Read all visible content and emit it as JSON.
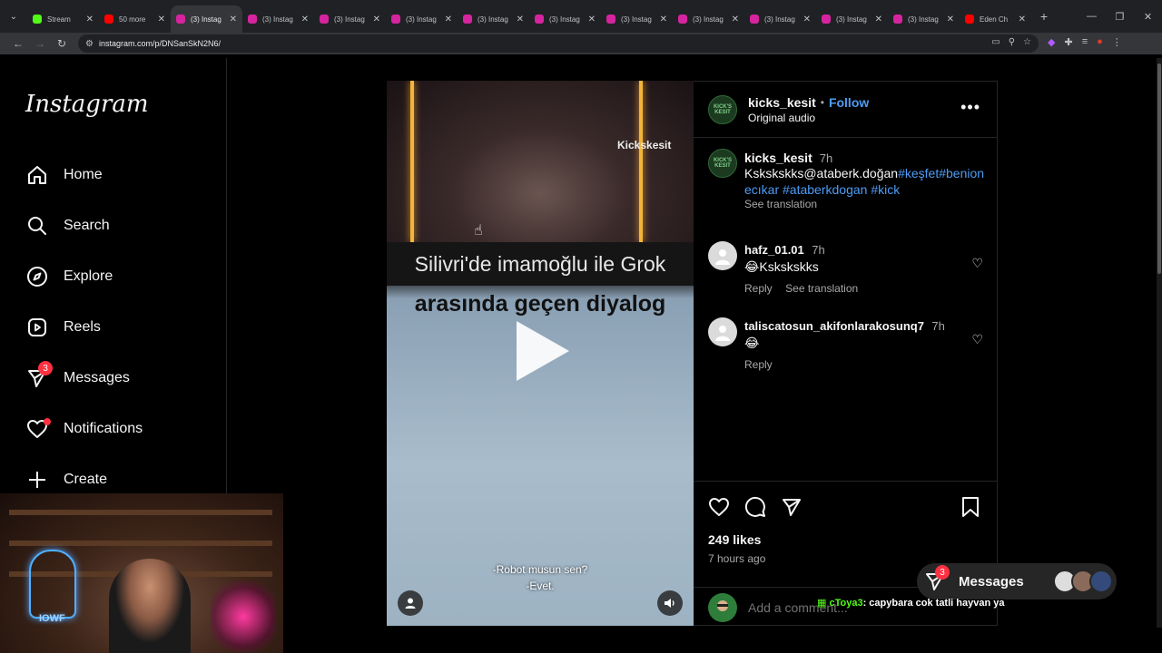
{
  "browser": {
    "tabs": [
      {
        "title": "Stream",
        "favicon_color": "#53fc18",
        "active": false
      },
      {
        "title": "50 more",
        "favicon_color": "#ff0000",
        "active": false
      },
      {
        "title": "(3) Instag",
        "favicon_color": "#d6249f",
        "active": true
      },
      {
        "title": "(3) Instag",
        "favicon_color": "#d6249f",
        "active": false
      },
      {
        "title": "(3) Instag",
        "favicon_color": "#d6249f",
        "active": false
      },
      {
        "title": "(3) Instag",
        "favicon_color": "#d6249f",
        "active": false
      },
      {
        "title": "(3) Instag",
        "favicon_color": "#d6249f",
        "active": false
      },
      {
        "title": "(3) Instag",
        "favicon_color": "#d6249f",
        "active": false
      },
      {
        "title": "(3) Instag",
        "favicon_color": "#d6249f",
        "active": false
      },
      {
        "title": "(3) Instag",
        "favicon_color": "#d6249f",
        "active": false
      },
      {
        "title": "(3) Instag",
        "favicon_color": "#d6249f",
        "active": false
      },
      {
        "title": "(3) Instag",
        "favicon_color": "#d6249f",
        "active": false
      },
      {
        "title": "(3) Instag",
        "favicon_color": "#d6249f",
        "active": false
      },
      {
        "title": "Eden Ch",
        "favicon_color": "#ff0000",
        "active": false
      }
    ],
    "url": "instagram.com/p/DNSanSkN2N6/"
  },
  "sidebar": {
    "logo": "Instagram",
    "items": [
      {
        "label": "Home",
        "icon": "home-icon"
      },
      {
        "label": "Search",
        "icon": "search-icon"
      },
      {
        "label": "Explore",
        "icon": "compass-icon"
      },
      {
        "label": "Reels",
        "icon": "reels-icon"
      },
      {
        "label": "Messages",
        "icon": "messenger-icon",
        "badge": "3"
      },
      {
        "label": "Notifications",
        "icon": "heart-icon",
        "dot": true
      },
      {
        "label": "Create",
        "icon": "plus-icon"
      }
    ]
  },
  "video": {
    "watermark": "Kickskesit",
    "caption_top": "Silivri'de  imamoğlu ile Grok",
    "caption_main": "arasında geçen diyalog",
    "subtitle_line1": "-Robot musun sen?",
    "subtitle_line2": "-Evet."
  },
  "post": {
    "author": "kicks_kesit",
    "avatar_text": "KICK'S KESIT",
    "follow_label": "Follow",
    "separator": "•",
    "audio": "Original audio",
    "caption_time": "7h",
    "caption_text": "Kskskskks@ataberk.doğan",
    "caption_tags_inline": "#keşfet#benion",
    "caption_tags_line2": "ecıkar #ataberkdogan #kick",
    "see_translation": "See translation",
    "likes": "249 likes",
    "posted": "7 hours ago",
    "add_comment_placeholder": "Add a comment..."
  },
  "comments": [
    {
      "user": "hafz_01.01",
      "time": "7h",
      "text": "😂Kskskskks",
      "reply": "Reply",
      "translation": "See translation"
    },
    {
      "user": "taliscatosun_akifonlarakosunq7",
      "time": "7h",
      "text": "😂",
      "reply": "Reply"
    }
  ],
  "messages_pill": {
    "label": "Messages",
    "badge": "3"
  },
  "stream_chat": {
    "user": "cToya3",
    "message": ": capybara cok tatli hayvan ya"
  },
  "webcam": {
    "neon_label": "IOWF"
  }
}
